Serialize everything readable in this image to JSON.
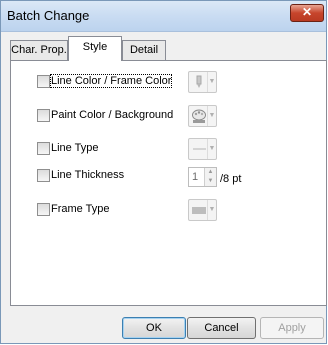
{
  "window": {
    "title": "Batch Change",
    "close_label": "✕"
  },
  "tabs": [
    {
      "label": "Char. Prop."
    },
    {
      "label": "Style"
    },
    {
      "label": "Detail"
    }
  ],
  "options": [
    {
      "label": "Line Color / Frame Color",
      "checked": false,
      "control_icon": "pen-icon"
    },
    {
      "label": "Paint Color / Background",
      "checked": false,
      "control_icon": "paint-palette-icon"
    },
    {
      "label": "Line Type",
      "checked": false,
      "control_icon": "line-type-icon"
    },
    {
      "label": "Line Thickness",
      "checked": false,
      "control_icon": "spinner"
    },
    {
      "label": "Frame Type",
      "checked": false,
      "control_icon": "frame-type-icon"
    }
  ],
  "line_thickness": {
    "value": "1",
    "unit": "/8 pt"
  },
  "buttons": {
    "ok": "OK",
    "cancel": "Cancel",
    "apply": "Apply"
  },
  "colors": {
    "titlebar": "#c9dcf2",
    "close": "#c7452c",
    "dialog_bg": "#f0f0f0",
    "panel_bg": "#ffffff"
  }
}
